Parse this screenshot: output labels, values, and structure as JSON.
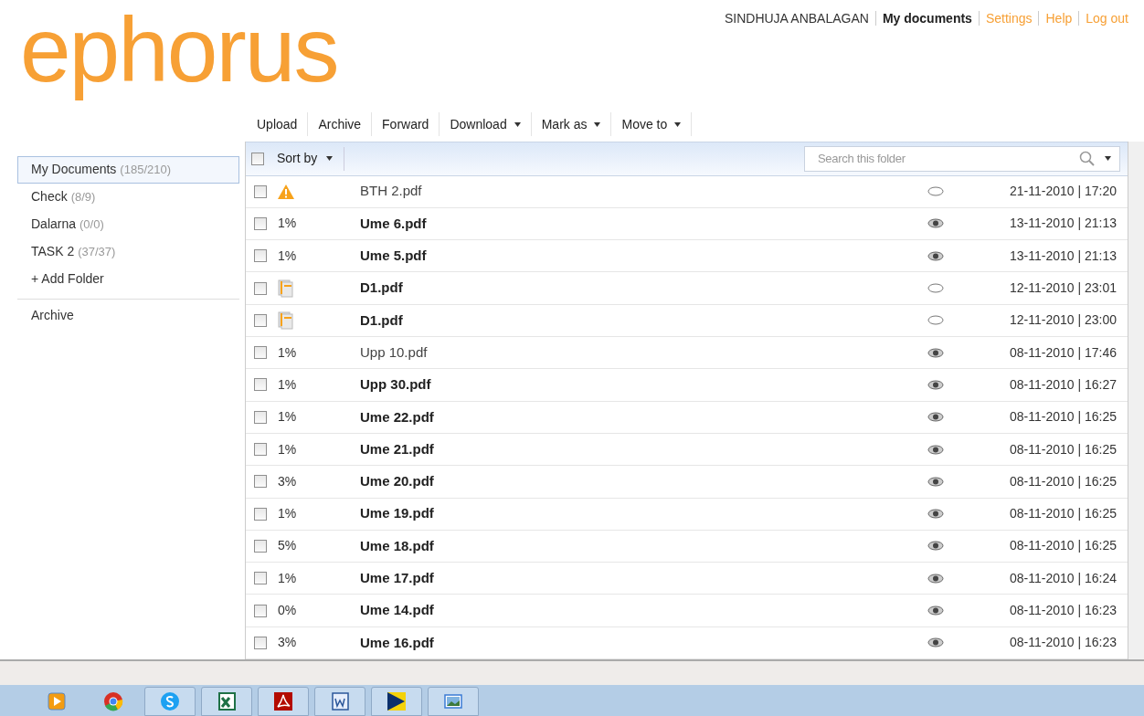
{
  "logo": "ephorus",
  "top_nav": [
    {
      "label": "SINDHUJA ANBALAGAN",
      "kind": "user",
      "selected": false
    },
    {
      "label": "My documents",
      "kind": "link",
      "selected": true
    },
    {
      "label": "Settings",
      "kind": "link",
      "selected": false
    },
    {
      "label": "Help",
      "kind": "link",
      "selected": false
    },
    {
      "label": "Log out",
      "kind": "link",
      "selected": false
    }
  ],
  "toolbar": [
    {
      "label": "Upload",
      "dropdown": false
    },
    {
      "label": "Archive",
      "dropdown": false
    },
    {
      "label": "Forward",
      "dropdown": false
    },
    {
      "label": "Download",
      "dropdown": true
    },
    {
      "label": "Mark as",
      "dropdown": true
    },
    {
      "label": "Move to",
      "dropdown": true
    }
  ],
  "sidebar": {
    "folders": [
      {
        "name": "My Documents",
        "count": "(185/210)",
        "selected": true
      },
      {
        "name": "Check",
        "count": "(8/9)",
        "selected": false
      },
      {
        "name": "Dalarna",
        "count": "(0/0)",
        "selected": false
      },
      {
        "name": "TASK 2",
        "count": "(37/37)",
        "selected": false
      }
    ],
    "add_folder": "+ Add Folder",
    "archive": "Archive"
  },
  "list_header": {
    "select_all_checked": false,
    "sort_label": "Sort by",
    "search_placeholder": "Search this folder"
  },
  "rows": [
    {
      "checked": false,
      "kind": "warning",
      "name": "BTH 2.pdf",
      "unread": false,
      "viewed": false,
      "date": "21-11-2010 | 17:20"
    },
    {
      "checked": false,
      "kind": "percent",
      "score": "1%",
      "name": "Ume 6.pdf",
      "unread": true,
      "viewed": true,
      "date": "13-11-2010 | 21:13"
    },
    {
      "checked": false,
      "kind": "percent",
      "score": "1%",
      "name": "Ume 5.pdf",
      "unread": true,
      "viewed": true,
      "date": "13-11-2010 | 21:13"
    },
    {
      "checked": false,
      "kind": "documents",
      "name": "D1.pdf",
      "unread": true,
      "viewed": false,
      "date": "12-11-2010 | 23:01"
    },
    {
      "checked": false,
      "kind": "documents",
      "name": "D1.pdf",
      "unread": true,
      "viewed": false,
      "date": "12-11-2010 | 23:00"
    },
    {
      "checked": false,
      "kind": "percent",
      "score": "1%",
      "name": "Upp 10.pdf",
      "unread": false,
      "viewed": true,
      "date": "08-11-2010 | 17:46"
    },
    {
      "checked": false,
      "kind": "percent",
      "score": "1%",
      "name": "Upp 30.pdf",
      "unread": true,
      "viewed": true,
      "date": "08-11-2010 | 16:27"
    },
    {
      "checked": false,
      "kind": "percent",
      "score": "1%",
      "name": "Ume 22.pdf",
      "unread": true,
      "viewed": true,
      "date": "08-11-2010 | 16:25"
    },
    {
      "checked": false,
      "kind": "percent",
      "score": "1%",
      "name": "Ume 21.pdf",
      "unread": true,
      "viewed": true,
      "date": "08-11-2010 | 16:25"
    },
    {
      "checked": false,
      "kind": "percent",
      "score": "3%",
      "name": "Ume 20.pdf",
      "unread": true,
      "viewed": true,
      "date": "08-11-2010 | 16:25"
    },
    {
      "checked": false,
      "kind": "percent",
      "score": "1%",
      "name": "Ume 19.pdf",
      "unread": true,
      "viewed": true,
      "date": "08-11-2010 | 16:25"
    },
    {
      "checked": false,
      "kind": "percent",
      "score": "5%",
      "name": "Ume 18.pdf",
      "unread": true,
      "viewed": true,
      "date": "08-11-2010 | 16:25"
    },
    {
      "checked": false,
      "kind": "percent",
      "score": "1%",
      "name": "Ume 17.pdf",
      "unread": true,
      "viewed": true,
      "date": "08-11-2010 | 16:24"
    },
    {
      "checked": false,
      "kind": "percent",
      "score": "0%",
      "name": "Ume 14.pdf",
      "unread": true,
      "viewed": true,
      "date": "08-11-2010 | 16:23"
    },
    {
      "checked": false,
      "kind": "percent",
      "score": "3%",
      "name": "Ume 16.pdf",
      "unread": true,
      "viewed": true,
      "date": "08-11-2010 | 16:23"
    }
  ]
}
